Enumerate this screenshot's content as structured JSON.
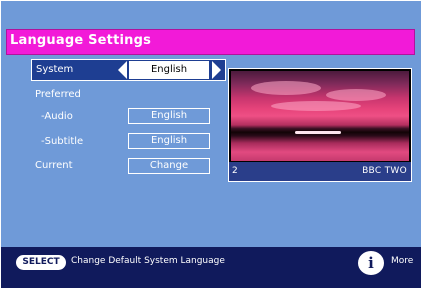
{
  "header": {
    "title": "Language Settings"
  },
  "system": {
    "label": "System",
    "value": "English"
  },
  "preferred": {
    "label": "Preferred",
    "audio": {
      "label": "-Audio",
      "value": "English"
    },
    "subtitle": {
      "label": "-Subtitle",
      "value": "English"
    }
  },
  "current": {
    "label": "Current",
    "button": "Change"
  },
  "preview": {
    "channel_number": "2",
    "channel_name": "BBC TWO"
  },
  "footer": {
    "select_key": "SELECT",
    "hint": "Change Default System Language",
    "info_key": "i",
    "more_label": "More"
  },
  "colors": {
    "background": "#6f9ad8",
    "title_bar": "#f21ad8",
    "selected_row": "#1e3e92",
    "footer": "#101a5c"
  }
}
